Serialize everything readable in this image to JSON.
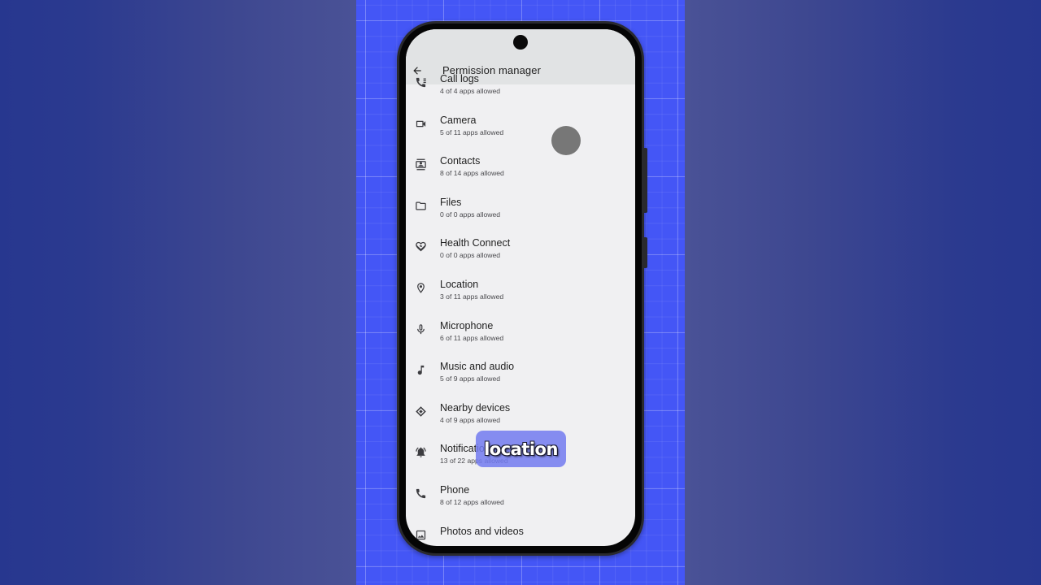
{
  "app_bar": {
    "title": "Permission manager",
    "back_icon": "arrow-back-icon"
  },
  "permissions": [
    {
      "label": "Call logs",
      "sub": "4 of 4 apps allowed",
      "icon": "call-log-icon"
    },
    {
      "label": "Camera",
      "sub": "5 of 11 apps allowed",
      "icon": "videocam-icon"
    },
    {
      "label": "Contacts",
      "sub": "8 of 14 apps allowed",
      "icon": "contacts-icon"
    },
    {
      "label": "Files",
      "sub": "0 of 0 apps allowed",
      "icon": "folder-icon"
    },
    {
      "label": "Health Connect",
      "sub": "0 of 0 apps allowed",
      "icon": "health-connect-icon"
    },
    {
      "label": "Location",
      "sub": "3 of 11 apps allowed",
      "icon": "location-pin-icon"
    },
    {
      "label": "Microphone",
      "sub": "6 of 11 apps allowed",
      "icon": "microphone-icon"
    },
    {
      "label": "Music and audio",
      "sub": "5 of 9 apps allowed",
      "icon": "music-note-icon"
    },
    {
      "label": "Nearby devices",
      "sub": "4 of 9 apps allowed",
      "icon": "nearby-devices-icon"
    },
    {
      "label": "Notifications",
      "sub": "13 of 22 apps allowed",
      "icon": "notifications-active-icon"
    },
    {
      "label": "Phone",
      "sub": "8 of 12 apps allowed",
      "icon": "phone-icon"
    },
    {
      "label": "Photos and videos",
      "sub": "",
      "icon": "photos-icon"
    }
  ],
  "caption": {
    "text": "location"
  },
  "colors": {
    "stage_blue": "#4456f6",
    "background_dark": "#27378f",
    "background_light": "#4a5296",
    "screen_bg": "#f0f0f2",
    "header_bg": "#e1e3e4",
    "caption_bg": "#727af0",
    "touch_indicator": "#777777"
  }
}
